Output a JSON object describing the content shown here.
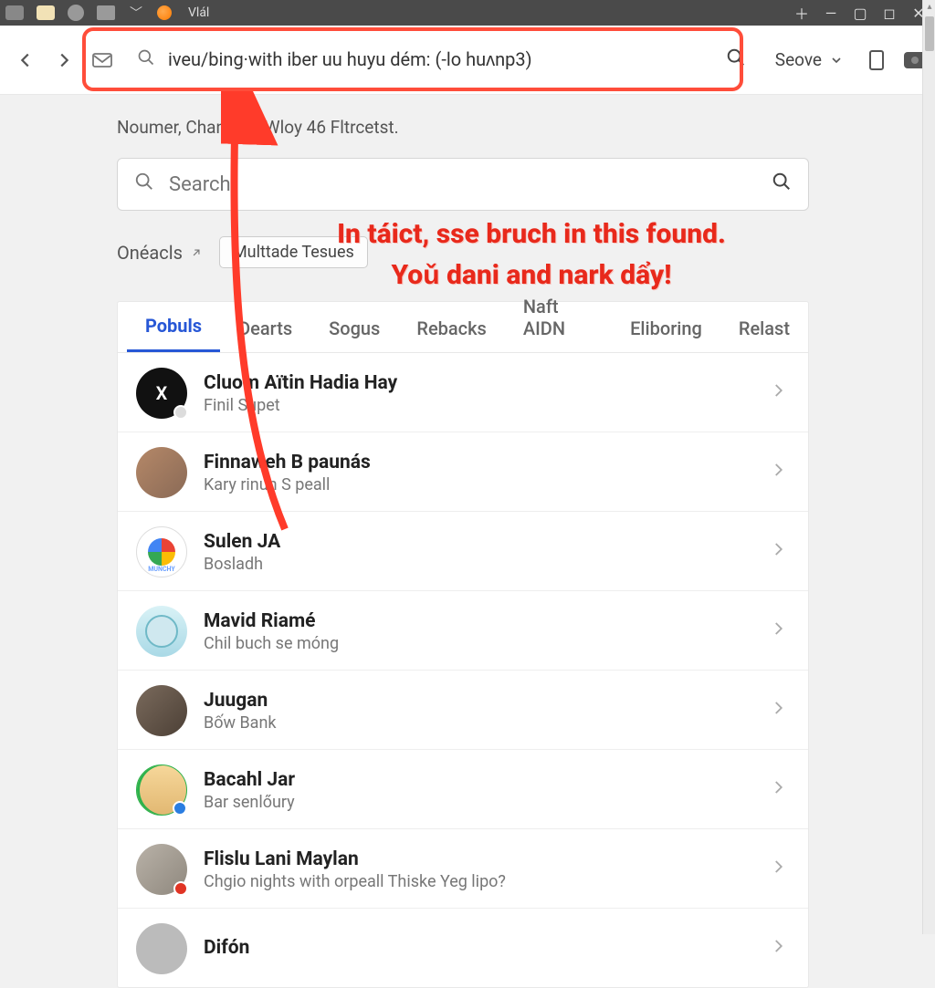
{
  "titlebar": {
    "title": "Vlál",
    "icons": [
      "app-icon",
      "message-icon",
      "notify-icon",
      "device-icon",
      "chevron-down-icon",
      "profile-icon"
    ]
  },
  "toolbar": {
    "addr_value": "iveu/bing·with iber uu huyu dém: (-lo huʌnp3)",
    "dropdown_label": "Seove"
  },
  "breadcrumb": "Noumer, Chantond Wloy 46 Fltrcetst.",
  "search": {
    "placeholder": "Search"
  },
  "filters": {
    "label": "Onéacls",
    "chip": "Multtade Tesues"
  },
  "tabs": [
    "Pobuls",
    "Dearts",
    "Sogus",
    "Rebacks",
    "Naft AIDN",
    "Eliboring",
    "Relast"
  ],
  "active_tab_index": 0,
  "rows": [
    {
      "title": "Cluom Aïtin  Hadia Hay",
      "sub": "Finil Supet",
      "avatar_letter": "X",
      "avatar_class": "av1",
      "badge_color": "#dcdcdc"
    },
    {
      "title": "Finnaweh B  paunás",
      "sub": "Kary rinun S  peall",
      "avatar_class": "av2"
    },
    {
      "title": "Sulen JA",
      "sub": "Bosladh",
      "avatar_class": "av3"
    },
    {
      "title": "Mavid Riamé",
      "sub": "Chil buch se móng",
      "avatar_class": "av4"
    },
    {
      "title": "Juugan",
      "sub": "Bốw Bank",
      "avatar_class": "av5"
    },
    {
      "title": "Bacahl Jar",
      "sub": "Bar senlőury",
      "avatar_class": "av6 av6-border",
      "badge_color": "#2a7de1"
    },
    {
      "title": "Flislu Lani Maylan",
      "sub": "Chgio nights with orpeall Thiske Yeg lipo?",
      "avatar_class": "av7",
      "badge_color": "#e03424"
    },
    {
      "title": "Difón",
      "sub": "",
      "avatar_class": "av8"
    }
  ],
  "annotation": {
    "line1": "In táict, sse bruch in this found.",
    "line2": "Yoǔ dani and nark dẩy!"
  }
}
